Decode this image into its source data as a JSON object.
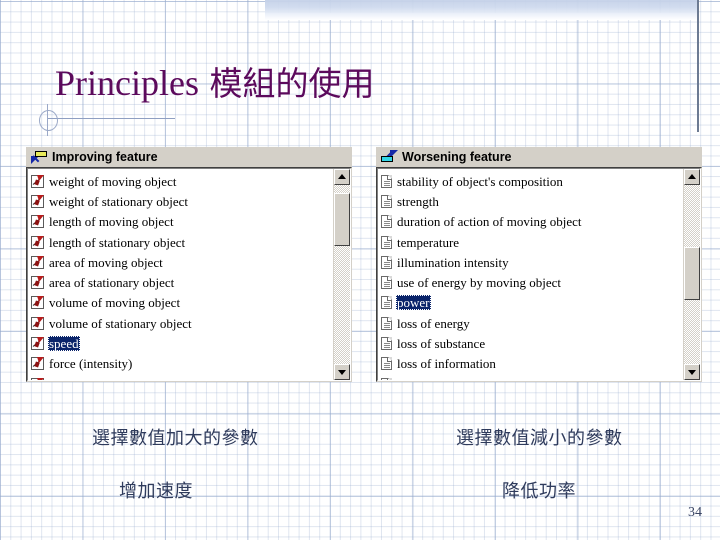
{
  "slide": {
    "title_latin": "Principles",
    "title_cjk": " 模組的使用",
    "page_number": "34",
    "accent_color": "#5c0a5c",
    "caption_color": "#2f3b5c",
    "selection_color": "#0a246a"
  },
  "improving_panel": {
    "header": "Improving feature",
    "header_icon": "improving-feature-icon",
    "items": [
      {
        "label": "weight of moving object",
        "selected": false
      },
      {
        "label": "weight of stationary object",
        "selected": false
      },
      {
        "label": "length of moving object",
        "selected": false
      },
      {
        "label": "length of stationary object",
        "selected": false
      },
      {
        "label": "area of moving object",
        "selected": false
      },
      {
        "label": "area of stationary object",
        "selected": false
      },
      {
        "label": "volume of moving object",
        "selected": false
      },
      {
        "label": "volume of stationary object",
        "selected": false
      },
      {
        "label": "speed",
        "selected": true
      },
      {
        "label": "force (intensity)",
        "selected": false
      }
    ],
    "scrollbar": {
      "up_arrow": "scroll-up-arrow",
      "down_arrow": "scroll-down-arrow",
      "thumb_top_pct": 8,
      "thumb_height_pct": 25
    }
  },
  "worsening_panel": {
    "header": "Worsening feature",
    "header_icon": "worsening-feature-icon",
    "items": [
      {
        "label": "stability of object's composition",
        "selected": false
      },
      {
        "label": "strength",
        "selected": false
      },
      {
        "label": "duration of action of moving object",
        "selected": false
      },
      {
        "label": "temperature",
        "selected": false
      },
      {
        "label": "illumination intensity",
        "selected": false
      },
      {
        "label": "use of energy by moving object",
        "selected": false
      },
      {
        "label": "power",
        "selected": true
      },
      {
        "label": "loss of energy",
        "selected": false
      },
      {
        "label": "loss of substance",
        "selected": false
      },
      {
        "label": "loss of information",
        "selected": false
      }
    ],
    "scrollbar": {
      "up_arrow": "scroll-up-arrow",
      "down_arrow": "scroll-down-arrow",
      "thumb_top_pct": 37,
      "thumb_height_pct": 25
    }
  },
  "captions": {
    "left_primary": "選擇數值加大的參數",
    "left_secondary": "增加速度",
    "right_primary": "選擇數值減小的參數",
    "right_secondary": "降低功率"
  }
}
